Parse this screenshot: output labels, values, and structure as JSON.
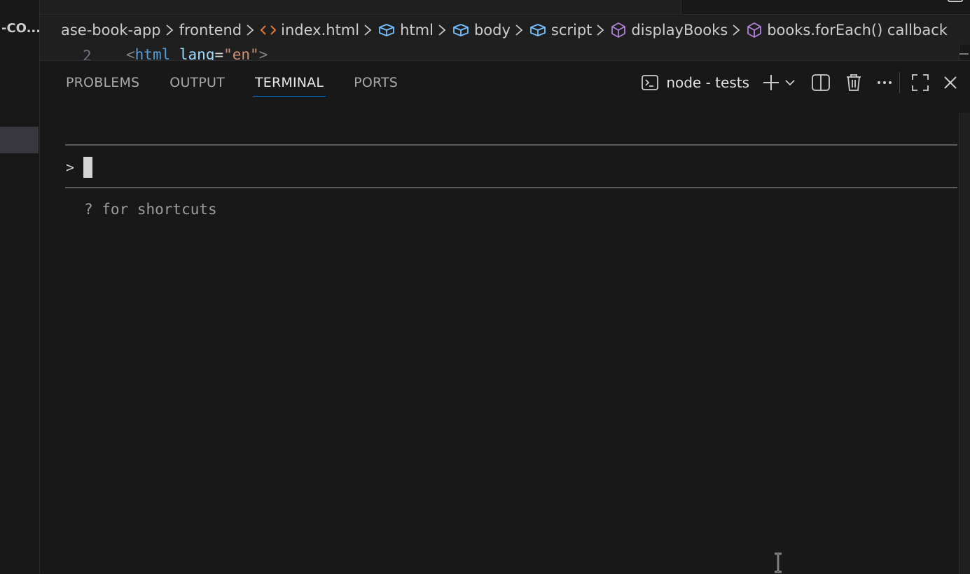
{
  "sidebar": {
    "title": "-CO..."
  },
  "breadcrumb": {
    "items": [
      {
        "label": "ase-book-app",
        "icon": ""
      },
      {
        "label": "frontend",
        "icon": ""
      },
      {
        "label": "index.html",
        "icon": "html-file-icon"
      },
      {
        "label": "html",
        "icon": "symbol-element-icon"
      },
      {
        "label": "body",
        "icon": "symbol-element-icon"
      },
      {
        "label": "script",
        "icon": "symbol-element-icon"
      },
      {
        "label": "displayBooks",
        "icon": "symbol-method-icon"
      },
      {
        "label": "books.forEach() callback",
        "icon": "symbol-method-icon"
      }
    ]
  },
  "editor": {
    "line_number": "2",
    "code": {
      "open": "<",
      "tag": "html",
      "attr": "lang",
      "eq": "=",
      "value": "\"en\"",
      "close": ">"
    }
  },
  "panel": {
    "tabs": [
      {
        "label": "PROBLEMS",
        "active": false
      },
      {
        "label": "OUTPUT",
        "active": false
      },
      {
        "label": "TERMINAL",
        "active": true
      },
      {
        "label": "PORTS",
        "active": false
      }
    ],
    "terminal_name": "node - tests",
    "icons": [
      "terminal-icon",
      "plus-icon",
      "chevron-down-icon",
      "split-icon",
      "trash-icon",
      "more-icon",
      "maximize-icon",
      "close-icon"
    ]
  },
  "terminal": {
    "prompt": ">",
    "hint": "? for shortcuts"
  },
  "colors": {
    "background": "#181818",
    "accent": "#0078d4",
    "symbol_icon": "#75beff",
    "method_icon": "#b180d7",
    "html_icon": "#e37933"
  }
}
